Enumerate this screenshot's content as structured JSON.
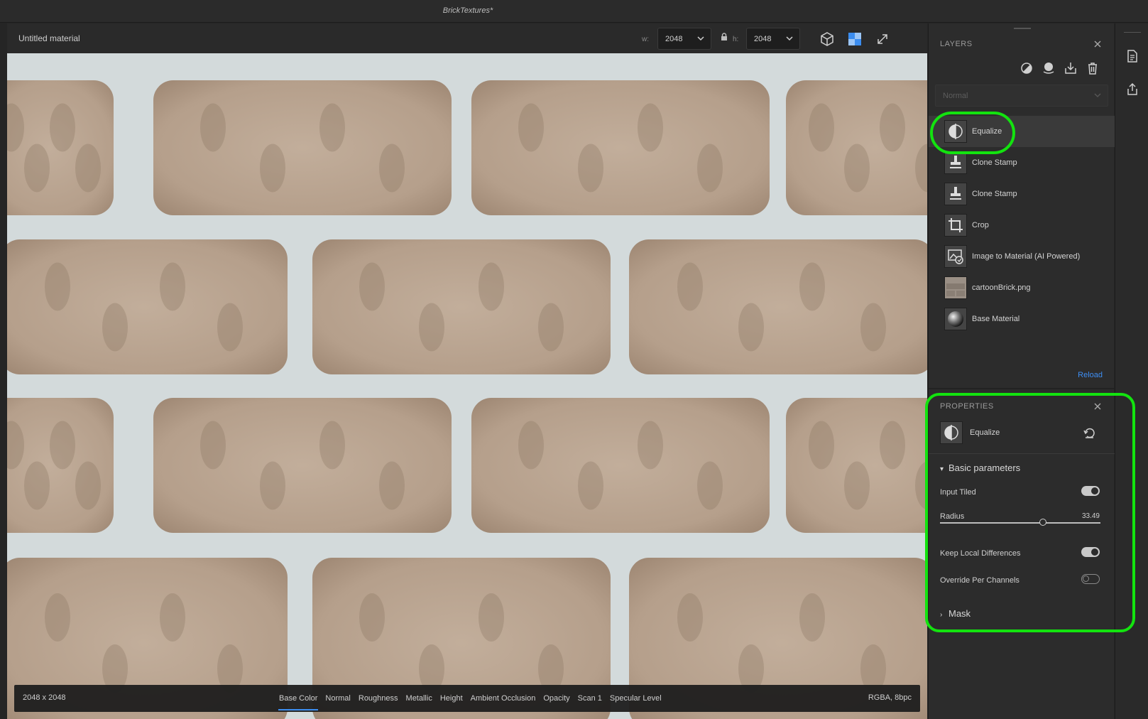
{
  "app": {
    "title": "BrickTextures*"
  },
  "document": {
    "name": "Untitled material",
    "width_label": "w:",
    "width_value": "2048",
    "height_label": "h:",
    "height_value": "2048"
  },
  "viewport": {
    "resolution": "2048 x 2048",
    "format": "RGBA, 8bpc",
    "active_channel": "Base Color",
    "channels": [
      "Base Color",
      "Normal",
      "Roughness",
      "Metallic",
      "Height",
      "Ambient Occlusion",
      "Opacity",
      "Scan 1",
      "Specular Level"
    ]
  },
  "layers_panel": {
    "title": "LAYERS",
    "blend_mode": "Normal",
    "reload_label": "Reload",
    "items": [
      {
        "label": "Equalize",
        "icon": "equalize-icon",
        "selected": true
      },
      {
        "label": "Clone Stamp",
        "icon": "clone-stamp-icon"
      },
      {
        "label": "Clone Stamp",
        "icon": "clone-stamp-icon"
      },
      {
        "label": "Crop",
        "icon": "crop-icon"
      },
      {
        "label": "Image to Material (AI Powered)",
        "icon": "image-to-material-icon"
      },
      {
        "label": "cartoonBrick.png",
        "icon": "image-thumbnail"
      },
      {
        "label": "Base Material",
        "icon": "sphere-icon"
      }
    ]
  },
  "properties_panel": {
    "title": "PROPERTIES",
    "filter_name": "Equalize",
    "section_basic": "Basic parameters",
    "section_mask": "Mask",
    "input_tiled": {
      "label": "Input Tiled",
      "on": true
    },
    "radius": {
      "label": "Radius",
      "value": "33.49",
      "fraction": 0.64
    },
    "keep_local": {
      "label": "Keep Local Differences",
      "on": true
    },
    "override": {
      "label": "Override Per Channels",
      "on": false
    }
  },
  "colors": {
    "accent": "#3b8df0",
    "highlight": "#13e30f",
    "mortar": "#d3dadb",
    "brick": "#b59f8b"
  }
}
